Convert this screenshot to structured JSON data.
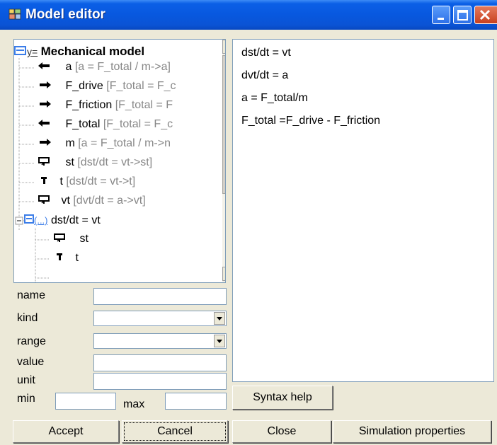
{
  "window": {
    "title": "Model editor",
    "accent": "#0858df",
    "close_color": "#c8401f"
  },
  "tree": {
    "root": {
      "prefix": "y=",
      "label": "Mechanical model"
    },
    "items": [
      {
        "icon": "arrow-left-icon",
        "name": "a",
        "detail": "[a = F_total / m->a]"
      },
      {
        "icon": "arrow-right-icon",
        "name": "F_drive",
        "detail": "[F_total = F_c"
      },
      {
        "icon": "arrow-right-icon",
        "name": "F_friction",
        "detail": "[F_total = F"
      },
      {
        "icon": "arrow-left-icon",
        "name": "F_total",
        "detail": "[F_total = F_c"
      },
      {
        "icon": "arrow-right-icon",
        "name": "m",
        "detail": "[a = F_total / m->n"
      },
      {
        "icon": "state-icon",
        "name": "st",
        "detail": "[dst/dt = vt->st]"
      },
      {
        "icon": "time-icon",
        "name": "t",
        "detail": "[dst/dt = vt->t]"
      },
      {
        "icon": "state-icon",
        "name": "vt",
        "detail": "[dvt/dt = a->vt]"
      }
    ],
    "sub": {
      "prefix": "(...)",
      "label": "dst/dt = vt",
      "children": [
        {
          "icon": "state-icon",
          "name": "st"
        },
        {
          "icon": "time-icon",
          "name": "t"
        }
      ]
    }
  },
  "editor": {
    "lines": [
      "dst/dt = vt",
      "dvt/dt = a",
      "a = F_total/m",
      "F_total =F_drive - F_friction"
    ]
  },
  "form": {
    "name_label": "name",
    "name_value": "",
    "kind_label": "kind",
    "kind_value": "",
    "range_label": "range",
    "range_value": "",
    "value_label": "value",
    "value_value": "",
    "unit_label": "unit",
    "unit_value": "",
    "min_label": "min",
    "min_value": "",
    "max_label": "max",
    "max_value": ""
  },
  "buttons": {
    "syntax_help": "Syntax help",
    "accept": "Accept",
    "cancel": "Cancel",
    "close": "Close",
    "simulation_properties": "Simulation properties"
  }
}
